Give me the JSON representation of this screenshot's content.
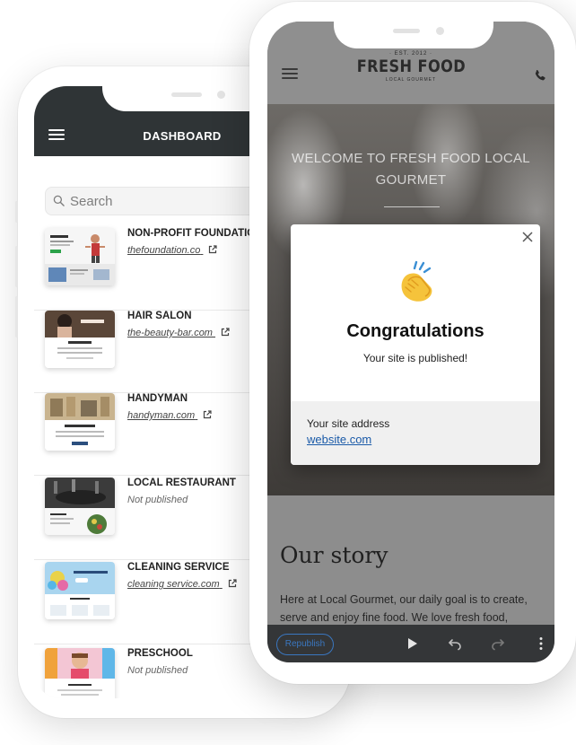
{
  "dashboard": {
    "title": "DASHBOARD",
    "search_placeholder": "Search",
    "sites": [
      {
        "name": "NON-PROFIT FOUNDATIC",
        "url": "thefoundation.co",
        "status": ""
      },
      {
        "name": "HAIR SALON",
        "url": "the-beauty-bar.com",
        "status": ""
      },
      {
        "name": "HANDYMAN",
        "url": "handyman.com",
        "status": ""
      },
      {
        "name": "LOCAL RESTAURANT",
        "url": "",
        "status": "Not published"
      },
      {
        "name": "CLEANING SERVICE",
        "url": "cleaning service.com",
        "status": ""
      },
      {
        "name": "PRESCHOOL",
        "url": "",
        "status": "Not published"
      }
    ]
  },
  "preview": {
    "brand_est": "· EST. 2012 ·",
    "brand_name": "FRESH FOOD",
    "brand_tagline": "LOCAL GOURMET",
    "hero_title": "WELCOME TO FRESH FOOD LOCAL GOURMET",
    "story_heading": "Our story",
    "story_text": "Here at Local Gourmet, our daily goal is to create, serve and enjoy fine food. We love fresh food,"
  },
  "modal": {
    "title": "Congratulations",
    "subtitle": "Your site is published!",
    "address_label": "Your site address",
    "address_link": "website.com"
  },
  "toolbar": {
    "republish_label": "Republish"
  },
  "colors": {
    "header_dark": "#2f3436",
    "link_blue": "#1a5aa8",
    "republish_blue": "#3a77c0"
  }
}
